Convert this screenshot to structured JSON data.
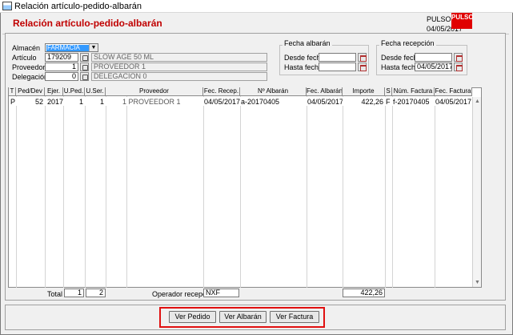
{
  "window": {
    "title": "Relación artículo-pedido-albarán"
  },
  "header": {
    "form_title": "Relación artículo-pedido-albarán",
    "app_name": "PULSO",
    "date": "04/05/2017",
    "logo_text": "PULSO",
    "accent_color": "#c00000"
  },
  "filters": {
    "almacen": {
      "label": "Almacén",
      "value": "FARMACIA"
    },
    "articulo": {
      "label": "Artículo",
      "code": "179209",
      "description": "SLOW AGE 50 ML"
    },
    "proveedor": {
      "label": "Proveedor",
      "code": "1",
      "description": "PROVEEDOR 1"
    },
    "delegacion": {
      "label": "Delegación",
      "code": "0",
      "description": "DELEGACION 0"
    },
    "fecha_albaran": {
      "title": "Fecha albarán",
      "desde_label": "Desde fecha",
      "desde_value": "",
      "hasta_label": "Hasta fecha",
      "hasta_value": ""
    },
    "fecha_recepcion": {
      "title": "Fecha recepción",
      "desde_label": "Desde fecha",
      "desde_value": "",
      "hasta_label": "Hasta fecha",
      "hasta_value": "04/05/2017"
    }
  },
  "grid": {
    "columns": [
      "T",
      "Ped/Dev",
      "Ejer.",
      "U.Ped.",
      "U.Ser.",
      "Proveedor",
      "Fec. Recep.",
      "Nº Albarán",
      "Fec. Albarán",
      "Importe",
      "S",
      "Núm. Factura",
      "Fec. Factura"
    ],
    "rows": [
      [
        "P",
        "52",
        "2017",
        "1",
        "1",
        "1 PROVEEDOR 1",
        "04/05/2017",
        "a-20170405",
        "04/05/2017",
        "422,26",
        "F",
        "f-20170405",
        "04/05/2017"
      ]
    ]
  },
  "totals": {
    "label": "Total",
    "u_ped": "1",
    "u_ser": "2",
    "operador_label": "Operador recepción",
    "operador_value": "NXF",
    "importe": "422,26"
  },
  "buttons": {
    "ver_pedido": "Ver Pedido",
    "ver_albaran": "Ver Albarán",
    "ver_factura": "Ver Factura"
  }
}
